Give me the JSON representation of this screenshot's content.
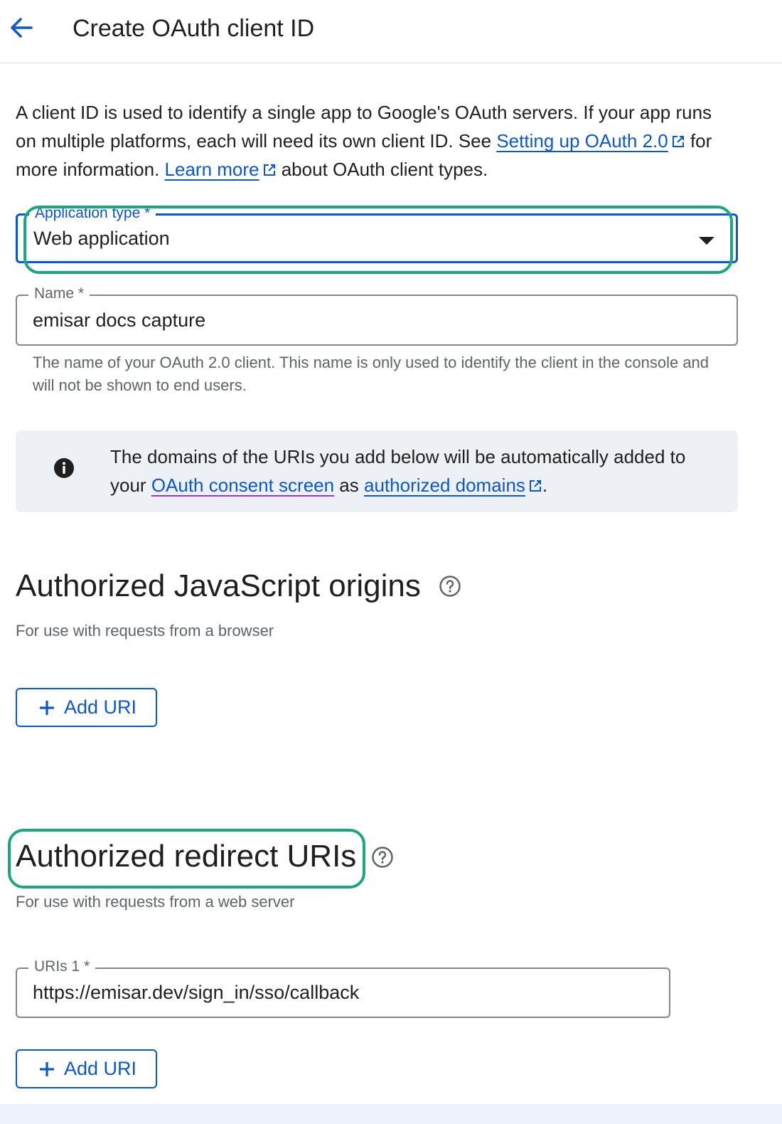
{
  "header": {
    "back_icon": "arrow-back-icon",
    "title": "Create OAuth client ID"
  },
  "intro": {
    "text_1": "A client ID is used to identify a single app to Google's OAuth servers. If your app runs on multiple platforms, each will need its own client ID. See ",
    "link_setup": "Setting up OAuth 2.0",
    "text_2": " for more information. ",
    "link_learn": "Learn more",
    "text_3": " about OAuth client types."
  },
  "application_type": {
    "label": "Application type *",
    "value": "Web application"
  },
  "name_field": {
    "label": "Name *",
    "value": "emisar docs capture",
    "helper": "The name of your OAuth 2.0 client. This name is only used to identify the client in the console and will not be shown to end users."
  },
  "info_box": {
    "icon": "info-icon",
    "text_1": "The domains of the URIs you add below will be automatically added to your ",
    "link_consent": "OAuth consent screen",
    "text_2": " as ",
    "link_domains": "authorized domains",
    "text_3": "."
  },
  "js_origins": {
    "title": "Authorized JavaScript origins",
    "help_icon": "help-circle-icon",
    "subtitle": "For use with requests from a browser",
    "add_button": "Add URI"
  },
  "redirect_uris": {
    "title": "Authorized redirect URIs",
    "help_icon": "help-circle-icon",
    "subtitle": "For use with requests from a web server",
    "uri_label": "URIs 1 *",
    "uri_value": "https://emisar.dev/sign_in/sso/callback",
    "add_button": "Add URI"
  },
  "colors": {
    "accent": "#0b57d0",
    "highlight": "#1aa77b",
    "info_bg": "#edf0f4"
  }
}
